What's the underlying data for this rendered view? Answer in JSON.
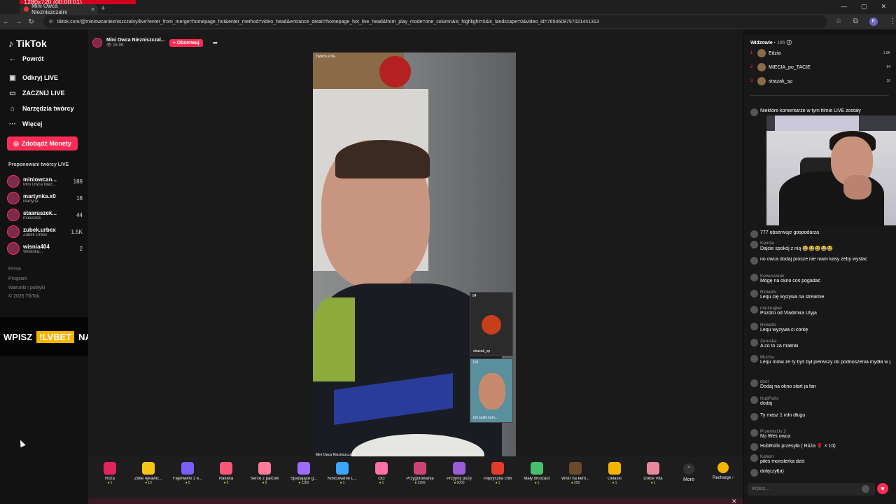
{
  "browser": {
    "recording_text": "1280x720 (00:00:01)",
    "tab_title": "Mini Owca Niezniszczalni",
    "url": "tiktok.com/@miniowcaniezniszczalny/live?enter_from_merge=homepage_hot&enter_method=video_head&entrance_detail=homepage_hot_live_head&from_play_mode=one_column&is_highlight=0&is_landscape=0&video_id=7654609757021441313",
    "profile_initial": "K"
  },
  "sidebar": {
    "logo": "TikTok",
    "items": [
      {
        "label": "Powrót",
        "icon": "back-icon"
      },
      {
        "label": "Odkryj LIVE",
        "icon": "discover-icon"
      },
      {
        "label": "ZACZNIJ LIVE",
        "icon": "go-live-icon"
      },
      {
        "label": "Narzędzia twórcy",
        "icon": "creator-tools-icon"
      },
      {
        "label": "Więcej",
        "icon": "more-icon"
      }
    ],
    "coins_button": "Zdobądź Monety",
    "suggested_title": "Proponowani twórcy LIVE",
    "creators": [
      {
        "name": "miniowcan...",
        "sub": "Mini Owca Niez...",
        "count": "188"
      },
      {
        "name": "martynka.x0",
        "sub": "Martyna",
        "count": "18"
      },
      {
        "name": "staaruszek...",
        "sub": "maluszek",
        "count": "44"
      },
      {
        "name": "zubek.urbex",
        "sub": "Zubek Urbex",
        "count": "1.5K"
      },
      {
        "name": "wisnia404",
        "sub": "Wiśenka...",
        "count": "2"
      }
    ],
    "footer": [
      "Firma",
      "Program",
      "Warunki i polityki",
      "© 2026 TikTok"
    ]
  },
  "promo": {
    "left": "WPISZ",
    "tag": "!LVBET",
    "right": "NA CZACIE"
  },
  "stream": {
    "host_name": "Mini Owca Niezniszczal...",
    "host_views": "15.9K",
    "follow_label": "+ Obserwuj",
    "video_label": "Twórca LIVE",
    "video_caption": "Mini Owca Niezniszczalni",
    "guest1": {
      "badge": "84",
      "name": "strażak_sp"
    },
    "guest2": {
      "badge": "100",
      "name": "ból sadło kem..."
    }
  },
  "gifts": [
    {
      "name": "Róża",
      "price": "1",
      "color": "#e0245e"
    },
    {
      "name": "Złote rękawic...",
      "price": "10",
      "color": "#f5c518"
    },
    {
      "name": "Fajerwerki z e...",
      "price": "5",
      "color": "#7b5cff"
    },
    {
      "name": "Rakieta",
      "price": "5",
      "color": "#ff5577"
    },
    {
      "name": "Serce z palców",
      "price": "5",
      "color": "#ff7a9a"
    },
    {
      "name": "Spadające g...",
      "price": "1280",
      "color": "#9b6dff"
    },
    {
      "name": "Kibicowanie L...",
      "price": "1",
      "color": "#3da4ff"
    },
    {
      "name": "GG",
      "price": "1",
      "color": "#ff6fa8"
    },
    {
      "name": "Przygotowania",
      "price": "1999",
      "color": "#cc4477"
    },
    {
      "name": "Przyjmij pozę",
      "price": "6000",
      "color": "#9a5cd6"
    },
    {
      "name": "Papryczka chili",
      "price": "1",
      "color": "#e53b2b"
    },
    {
      "name": "Mały dinozaur",
      "price": "1",
      "color": "#47c06b"
    },
    {
      "name": "Wistr na kem...",
      "price": "399",
      "color": "#6a4a2a"
    },
    {
      "name": "Oklaski",
      "price": "1",
      "color": "#f5b400"
    },
    {
      "name": "Dolce Vita",
      "price": "1",
      "color": "#e8889c"
    }
  ],
  "gift_controls": {
    "more": "More",
    "recharge": "Recharge ›"
  },
  "viewers": {
    "title": "Widzowie",
    "count": "185",
    "top": [
      {
        "rank": "1",
        "name": "Edzia",
        "count": "1.8K"
      },
      {
        "rank": "2",
        "name": "MIECIA_po_TACIE",
        "count": "94"
      },
      {
        "rank": "3",
        "name": "strażak_sp",
        "count": "16"
      }
    ]
  },
  "chat": [
    {
      "user": "",
      "msg": "Niektóre komentarze w tym filmie LIVE zostały"
    },
    {
      "user": "",
      "msg": "777 obserwuje gospodarza"
    },
    {
      "user": "Kamila",
      "msg": "Dajcie spokój z nią 😂😂😂😂😂"
    },
    {
      "user": "",
      "msg": "no owca dodaj prosze nie mam kasy zeby wyslac"
    },
    {
      "user": "Kewusssiek",
      "msg": "Mogę na okno coś pogadać"
    },
    {
      "user": "Ricketts",
      "msg": "Lequ cię wyzywa na streamie"
    },
    {
      "user": "minimajkel",
      "msg": "Pozdro od Vladimira Utyja"
    },
    {
      "user": "Ricketts",
      "msg": "Lequ wyzywa ci córkę"
    },
    {
      "user": "Zeruśka",
      "msg": "A co to za malinki"
    },
    {
      "user": "Mucha",
      "msg": "Lequ mówi że ty byś był pierwszy do podnoszenia mydła w pace"
    },
    {
      "user": "dzel",
      "msg": "Dodaj na okno start ja fan"
    },
    {
      "user": "HubRollx",
      "msg": "dodaj"
    },
    {
      "user": "",
      "msg": "Ty masz 1 mln długu"
    },
    {
      "user": "PrzemixUs 2",
      "msg": "No Weś owca"
    },
    {
      "user": "",
      "msg": "HubRollx przesyła ( Róża 🌹 × 10)"
    },
    {
      "user": "Kafarrr",
      "msg": "piłeś monsterka dziś"
    },
    {
      "user": "",
      "msg": "dołączył(a)"
    }
  ],
  "chat_input_placeholder": "Wpisz..."
}
